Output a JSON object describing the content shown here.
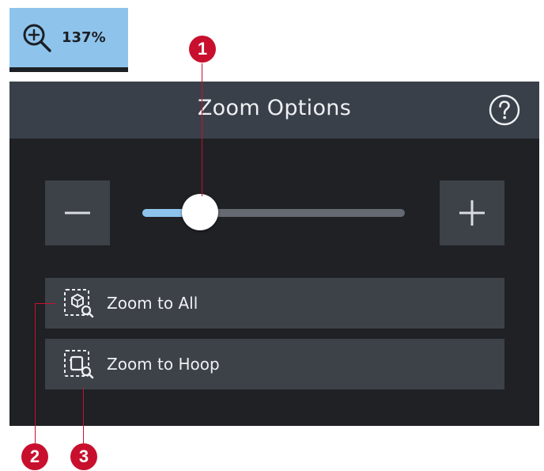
{
  "zoom_indicator": {
    "value": "137%",
    "icon": "zoom-in-icon"
  },
  "panel": {
    "title": "Zoom Options",
    "help_icon": "question-circle-icon",
    "zoom_out_icon": "minus-icon",
    "zoom_in_icon": "plus-icon",
    "slider_level": 0.22
  },
  "actions": [
    {
      "label": "Zoom to All",
      "icon": "zoom-to-all-icon"
    },
    {
      "label": "Zoom to Hoop",
      "icon": "zoom-to-hoop-icon"
    }
  ],
  "callouts": [
    {
      "number": "1"
    },
    {
      "number": "2"
    },
    {
      "number": "3"
    }
  ],
  "colors": {
    "accent": "#8ec4ec",
    "panel_bg": "#1f2125",
    "header_bg": "#3a4049",
    "button_bg": "#3d4148",
    "callout": "#c8102e"
  }
}
